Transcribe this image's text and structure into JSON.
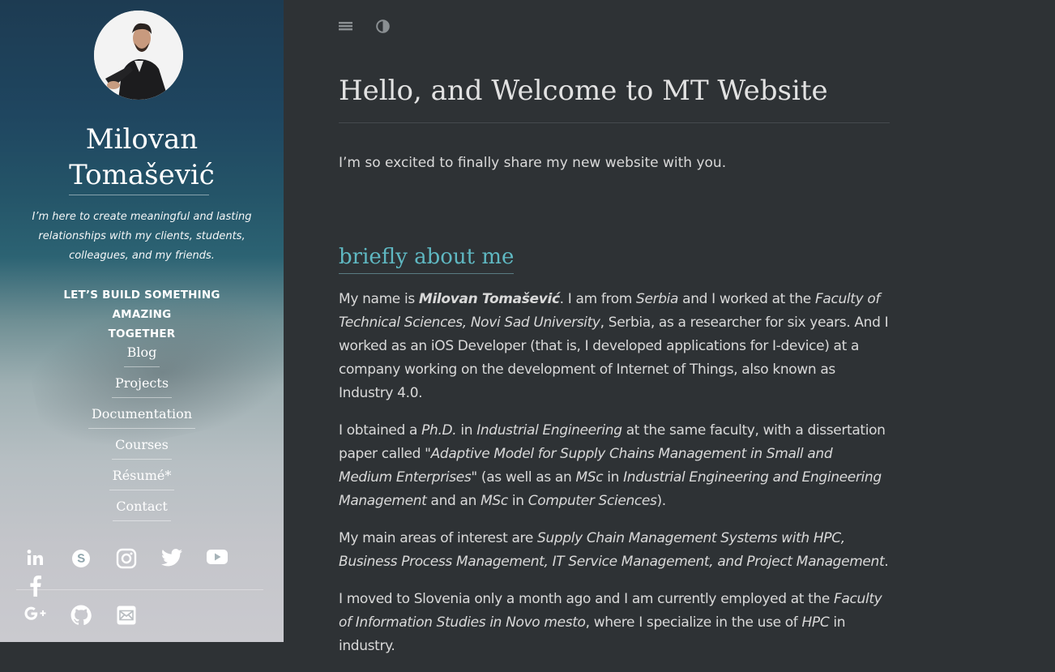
{
  "sidebar": {
    "name_line1": "Milovan",
    "name_line2": "Tomašević",
    "tagline_line1": "I’m here to create meaningful and lasting",
    "tagline_line2": "relationships with my clients, students,",
    "tagline_line3": "colleagues, and my friends.",
    "cta_line1": "LET’S BUILD SOMETHING AMAZING",
    "cta_line2": "TOGETHER",
    "nav": [
      {
        "label": "Blog"
      },
      {
        "label": "Projects"
      },
      {
        "label": "Documentation"
      },
      {
        "label": "Courses"
      },
      {
        "label": "Résumé*"
      },
      {
        "label": "Contact"
      }
    ],
    "social_icons": [
      "linkedin-icon",
      "skype-icon",
      "instagram-icon",
      "twitter-icon",
      "youtube-icon",
      "facebook-icon",
      "google-plus-icon",
      "github-icon",
      "email-icon"
    ]
  },
  "toolbar": {
    "menu_icon": "menu-icon",
    "theme_icon": "contrast-icon"
  },
  "main": {
    "title": "Hello, and Welcome to MT Website",
    "intro": "I’m so excited to finally share my new website with you.",
    "section_heading": "briefly about me",
    "p1": {
      "a": "My name is ",
      "b": "Milovan Tomašević",
      "c": ". I am from ",
      "d": "Serbia",
      "e": " and I worked at the ",
      "f": "Faculty of Technical Sciences, Novi Sad University",
      "g": ", Serbia, as a researcher for six years. And I worked as an iOS Developer (that is, I developed applications for I-device) at a company working on the development of Internet of Things, also known as Industry 4.0."
    },
    "p2": {
      "a": "I obtained a ",
      "b": "Ph.D.",
      "c": " in ",
      "d": "Industrial Engineering",
      "e": " at the same faculty, with a dissertation paper called ",
      "f": "\"Adaptive Model for Supply Chains Management in Small and Medium Enterprises\"",
      "g": " (as well as an ",
      "h": "MSc",
      "i": " in ",
      "j": "Industrial Engineering and Engineering Management",
      "k": " and an ",
      "l": "MSc",
      "m": " in ",
      "n": "Computer Sciences",
      "o": ")."
    },
    "p3": {
      "a": "My main areas of interest are ",
      "b": "Supply Chain Management Systems with HPC, Business Process Management, IT Service Management, and Project Management",
      "c": "."
    },
    "p4": {
      "a": "I moved to Slovenia only a month ago and I am currently employed at the ",
      "b": "Faculty of Information Studies in Novo mesto",
      "c": ", where I specialize in the use of ",
      "d": "HPC",
      "e": " in industry."
    }
  },
  "colors": {
    "background": "#2e3235",
    "accent": "#5fb8c2",
    "text": "#d9d9d9"
  }
}
